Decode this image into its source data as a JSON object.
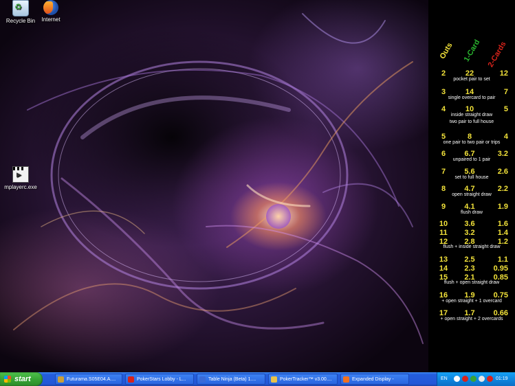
{
  "desktop": {
    "icons": [
      {
        "label": "Recycle Bin",
        "icon": "recycle-bin-icon"
      },
      {
        "label": "Internet",
        "icon": "firefox-icon"
      },
      {
        "label": "mplayerc.exe",
        "icon": "media-player-icon"
      }
    ]
  },
  "outs_chart": {
    "headers": {
      "outs": "Outs",
      "one_card": "1-Card",
      "two_cards": "2-Cards"
    },
    "header_colors": {
      "outs": "#f2e23a",
      "one_card": "#29b52e",
      "two_cards": "#d8231b"
    },
    "value_color": "#f2e23a",
    "rows": [
      {
        "outs": "2",
        "one": "22",
        "two": "12",
        "desc": "pocket pair to set"
      },
      {
        "outs": "3",
        "one": "14",
        "two": "7",
        "desc": "single overcard to pair"
      },
      {
        "outs": "4",
        "one": "10",
        "two": "5",
        "desc": "inside straight draw\ntwo pair to full house"
      },
      {
        "outs": "5",
        "one": "8",
        "two": "4",
        "desc": "one pair to two pair or trips"
      },
      {
        "outs": "6",
        "one": "6.7",
        "two": "3.2",
        "desc": "unpaired to 1 pair"
      },
      {
        "outs": "7",
        "one": "5.6",
        "two": "2.6",
        "desc": "set to full house"
      },
      {
        "outs": "8",
        "one": "4.7",
        "two": "2.2",
        "desc": "open straight draw"
      },
      {
        "outs": "9",
        "one": "4.1",
        "two": "1.9",
        "desc": "flush draw"
      },
      {
        "outs": "10",
        "one": "3.6",
        "two": "1.6",
        "desc": ""
      },
      {
        "outs": "11",
        "one": "3.2",
        "two": "1.4",
        "desc": ""
      },
      {
        "outs": "12",
        "one": "2.8",
        "two": "1.2",
        "desc": "flush + inside straight draw"
      },
      {
        "outs": "13",
        "one": "2.5",
        "two": "1.1",
        "desc": ""
      },
      {
        "outs": "14",
        "one": "2.3",
        "two": "0.95",
        "desc": ""
      },
      {
        "outs": "15",
        "one": "2.1",
        "two": "0.85",
        "desc": "flush + open straight draw"
      },
      {
        "outs": "16",
        "one": "1.9",
        "two": "0.75",
        "desc": "+ open straight + 1 overcard"
      },
      {
        "outs": "17",
        "one": "1.7",
        "two": "0.66",
        "desc": "+ open straight + 2 overcards"
      }
    ]
  },
  "taskbar": {
    "start_label": "start",
    "tasks": [
      {
        "label": "Futurama.S05E04.A....",
        "icon": "video-file-icon",
        "icon_color": "#c9a03a"
      },
      {
        "label": "PokerStars Lobby - L...",
        "icon": "pokerstars-icon",
        "icon_color": "#d8231b"
      },
      {
        "label": "Table Ninja (Beta) 1....",
        "icon": "table-ninja-icon",
        "icon_color": "#3a6bd8"
      },
      {
        "label": "PokerTracker™ v3.00....",
        "icon": "pokertracker-icon",
        "icon_color": "#e8c24a"
      },
      {
        "label": "Expanded Display -",
        "icon": "expanded-display-icon",
        "icon_color": "#f07020"
      }
    ],
    "tray": {
      "language": "EN",
      "clock": "01:19",
      "icons": [
        {
          "icon": "help-icon",
          "color": "#ffffff"
        },
        {
          "icon": "antivirus-icon",
          "color": "#d8231b"
        },
        {
          "icon": "network-icon",
          "color": "#38a436"
        },
        {
          "icon": "volume-icon",
          "color": "#e8e8e8"
        },
        {
          "icon": "security-shield-icon",
          "color": "#d8231b"
        }
      ]
    }
  }
}
